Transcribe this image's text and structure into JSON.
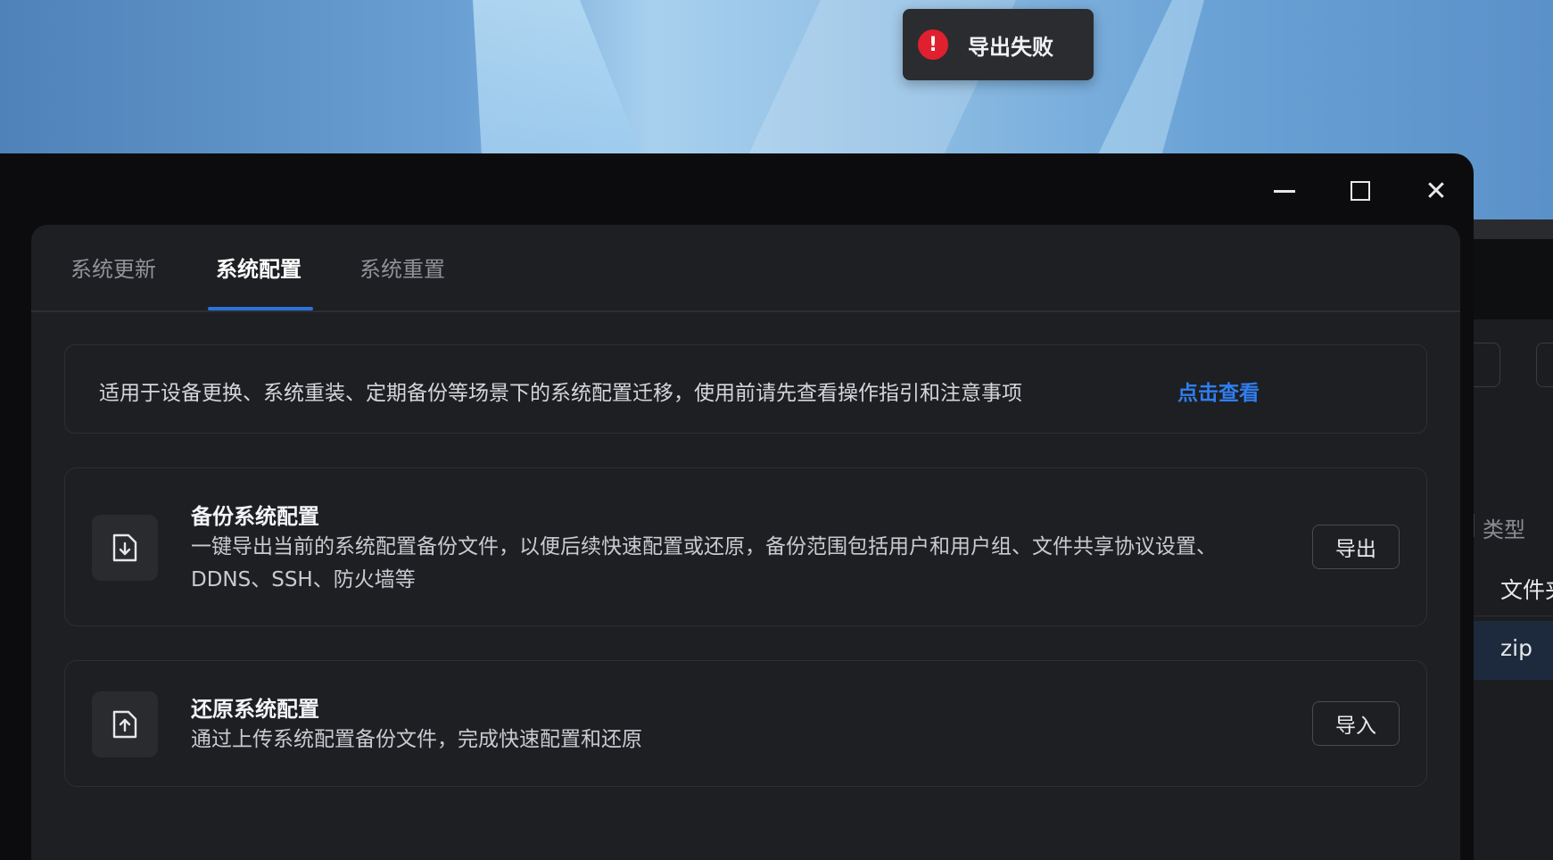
{
  "toast": {
    "message": "导出失败",
    "icon": "exclamation-icon",
    "icon_glyph": "!",
    "color": "#e0202e"
  },
  "window_controls": {
    "minimize": "minimize-icon",
    "maximize": "maximize-icon",
    "close": "close-icon",
    "close_glyph": "✕"
  },
  "tabs": [
    {
      "label": "系统更新",
      "active": false
    },
    {
      "label": "系统配置",
      "active": true
    },
    {
      "label": "系统重置",
      "active": false
    }
  ],
  "notice": {
    "text": "适用于设备更换、系统重装、定期备份等场景下的系统配置迁移，使用前请先查看操作指引和注意事项",
    "link": "点击查看"
  },
  "cards": [
    {
      "icon": "file-download-icon",
      "title": "备份系统配置",
      "description": "一键导出当前的系统配置备份文件，以便后续快速配置或还原，备份范围包括用户和用户组、文件共享协议设置、DDNS、SSH、防火墙等",
      "button": "导出"
    },
    {
      "icon": "file-upload-icon",
      "title": "还原系统配置",
      "description": "通过上传系统配置备份文件，完成快速配置和还原",
      "button": "导入"
    }
  ],
  "background_window": {
    "column_header": "类型",
    "rows": [
      "文件夹",
      "zip"
    ]
  },
  "colors": {
    "accent": "#2b72d9",
    "link": "#2f7ef0",
    "panel": "#1e1f22"
  }
}
